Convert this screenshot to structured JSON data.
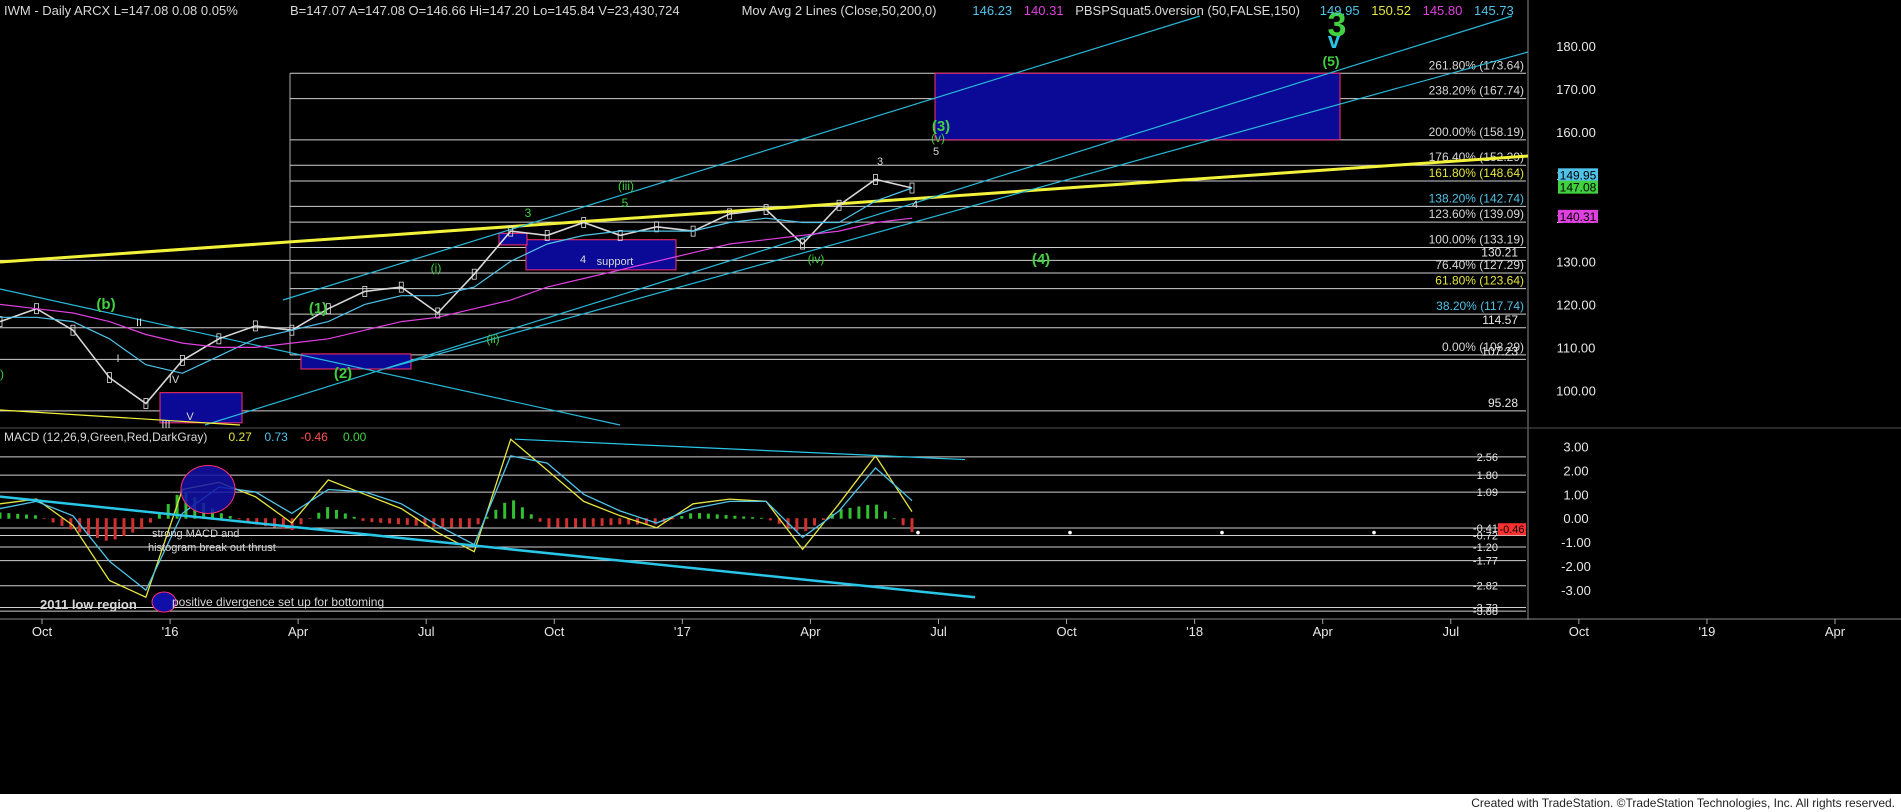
{
  "header": {
    "parts": [
      {
        "text": "IWM - Daily  ARCX  L=147.08  0.08  0.05%",
        "color": "#d8d8d8"
      },
      {
        "text": "B=147.07  A=147.08  O=146.66  Hi=147.20  Lo=145.84  V=23,430,724",
        "color": "#d8d8d8"
      },
      {
        "text": "Mov Avg 2 Lines (Close,50,200,0)",
        "color": "#d8d8d8"
      },
      {
        "text": "146.23",
        "color": "#4fc3e8"
      },
      {
        "text": "140.31",
        "color": "#e040e0"
      },
      {
        "text": "PBSPSquat5.0version (50,FALSE,150)",
        "color": "#d8d8d8"
      },
      {
        "text": "149.95",
        "color": "#4fc3e8"
      },
      {
        "text": "150.52",
        "color": "#e6e640"
      },
      {
        "text": "145.80",
        "color": "#e040e0"
      },
      {
        "text": "145.73",
        "color": "#4fc3e8"
      }
    ]
  },
  "macd_header": {
    "parts": [
      {
        "text": "MACD (12,26,9,Green,Red,DarkGray)",
        "color": "#d8d8d8"
      },
      {
        "text": "0.27",
        "color": "#e6e640"
      },
      {
        "text": "0.73",
        "color": "#4fc3e8"
      },
      {
        "text": "-0.46",
        "color": "#ff5050"
      },
      {
        "text": "0.00",
        "color": "#40d040"
      }
    ]
  },
  "price_axis": {
    "ticks": [
      "180.00",
      "170.00",
      "160.00",
      "150.00",
      "140.00",
      "130.00",
      "120.00",
      "110.00",
      "100.00"
    ],
    "ylim": [
      92,
      186
    ],
    "last_price_tags": [
      {
        "text": "149.95",
        "value": 149.95,
        "bg": "#4fc3e8",
        "fg": "#000"
      },
      {
        "text": "147.08",
        "value": 147.08,
        "bg": "#40d040",
        "fg": "#000"
      },
      {
        "text": "140.31",
        "value": 140.31,
        "bg": "#e040e0",
        "fg": "#000"
      }
    ]
  },
  "macd_axis": {
    "ticks": [
      "3.00",
      "2.00",
      "1.00",
      "0.00",
      "-1.00",
      "-2.00",
      "-3.00"
    ],
    "ylim": [
      -4.0,
      3.6
    ],
    "level_labels": [
      "2.56",
      "1.80",
      "1.09",
      "-0.41",
      "-0.72",
      "-1.20",
      "-1.77",
      "-2.82",
      "-3.73",
      "-3.88"
    ],
    "tag": {
      "text": "-0.46",
      "bg": "#ff3030",
      "fg": "#000"
    }
  },
  "time_axis": {
    "labels": [
      "Oct",
      "'16",
      "Apr",
      "Jul",
      "Oct",
      "'17",
      "Apr",
      "Jul",
      "Oct",
      "'18",
      "Apr",
      "Jul",
      "Oct",
      "'19",
      "Apr"
    ]
  },
  "fib_levels": [
    {
      "label": "261.80% (173.64)",
      "value": 173.64,
      "color": "#d8d8d8"
    },
    {
      "label": "238.20% (167.74)",
      "value": 167.74,
      "color": "#d8d8d8"
    },
    {
      "label": "200.00% (158.19)",
      "value": 158.19,
      "color": "#d8d8d8"
    },
    {
      "label": "176.40% (152.29)",
      "value": 152.29,
      "color": "#d8d8d8"
    },
    {
      "label": "161.80% (148.64)",
      "value": 148.64,
      "color": "#e6e640"
    },
    {
      "label": "138.20% (142.74)",
      "value": 142.74,
      "color": "#4fc3e8"
    },
    {
      "label": "123.60% (139.09)",
      "value": 139.09,
      "color": "#d8d8d8"
    },
    {
      "label": "100.00% (133.19)",
      "value": 133.19,
      "color": "#d8d8d8"
    },
    {
      "label": "76.40% (127.29)",
      "value": 127.29,
      "color": "#d8d8d8"
    },
    {
      "label": "61.80% (123.64)",
      "value": 123.64,
      "color": "#e6e640"
    },
    {
      "label": "38.20% (117.74)",
      "value": 117.74,
      "color": "#4fc3e8"
    },
    {
      "label": "0.00% (108.29)",
      "value": 108.29,
      "color": "#d8d8d8"
    }
  ],
  "horizontal_levels": [
    {
      "label": "130.21",
      "value": 130.21
    },
    {
      "label": "114.57",
      "value": 114.57
    },
    {
      "label": "107.23",
      "value": 107.23
    },
    {
      "label": "95.28",
      "value": 95.28
    }
  ],
  "wave_labels": [
    {
      "text": "3",
      "color": "#40d040",
      "size": 34
    },
    {
      "text": "v",
      "color": "#29c6e8",
      "size": 22
    },
    {
      "text": "(5)",
      "color": "#40d040",
      "size": 14
    },
    {
      "text": "(3)",
      "color": "#40d040",
      "size": 15
    },
    {
      "text": "(v)",
      "color": "#40d040",
      "size": 12
    },
    {
      "text": "5",
      "color": "#d8d8d8",
      "size": 11
    },
    {
      "text": "3",
      "color": "#d8d8d8",
      "size": 11
    },
    {
      "text": "4",
      "color": "#d8d8d8",
      "size": 11
    },
    {
      "text": "(4)",
      "color": "#40d040",
      "size": 15
    },
    {
      "text": "(iv)",
      "color": "#40d040",
      "size": 12
    },
    {
      "text": "(iii)",
      "color": "#40d040",
      "size": 12
    },
    {
      "text": "5",
      "color": "#40d040",
      "size": 12
    },
    {
      "text": "3",
      "color": "#40d040",
      "size": 12
    },
    {
      "text": "4",
      "color": "#d8d8d8",
      "size": 11
    },
    {
      "text": "support",
      "color": "#d8d8d8",
      "size": 11
    },
    {
      "text": "(i)",
      "color": "#40d040",
      "size": 12
    },
    {
      "text": "(ii)",
      "color": "#40d040",
      "size": 12
    },
    {
      "text": "(1)",
      "color": "#40d040",
      "size": 15
    },
    {
      "text": "(2)",
      "color": "#40d040",
      "size": 15
    },
    {
      "text": "(b)",
      "color": "#40d040",
      "size": 15
    },
    {
      "text": "I",
      "color": "#d8d8d8",
      "size": 11
    },
    {
      "text": "II",
      "color": "#d8d8d8",
      "size": 11
    },
    {
      "text": "IV",
      "color": "#d8d8d8",
      "size": 11
    },
    {
      "text": "III",
      "color": "#d8d8d8",
      "size": 11
    },
    {
      "text": "V",
      "color": "#d8d8d8",
      "size": 11
    },
    {
      "text": ")",
      "color": "#40d040",
      "size": 12
    }
  ],
  "macd_annotations": [
    {
      "text": "strong MACD  and",
      "color": "#d8d8d8"
    },
    {
      "text": "histogram break out thrust",
      "color": "#d8d8d8"
    },
    {
      "text": "2011 low region",
      "color": "#d8d8d8"
    },
    {
      "text": "positive divergence set up for bottoming",
      "color": "#d8d8d8"
    }
  ],
  "footer": {
    "text": "Created with TradeStation. ©TradeStation Technologies, Inc. All rights reserved."
  },
  "chart_data": [
    {
      "type": "candlestick-line",
      "title": "IWM - Daily ARCX",
      "ylim": [
        92,
        186
      ],
      "series": [
        {
          "name": "IWM",
          "color": "#d8d8d8",
          "x": [
            "2015-10",
            "2015-11",
            "2015-12",
            "2016-01",
            "2016-02",
            "2016-03",
            "2016-04",
            "2016-05",
            "2016-06",
            "2016-07",
            "2016-08",
            "2016-09",
            "2016-10",
            "2016-11",
            "2016-12",
            "2017-01",
            "2017-02",
            "2017-03",
            "2017-04",
            "2017-05",
            "2017-06",
            "2017-07",
            "2017-08",
            "2017-09",
            "2017-10",
            "2017-11"
          ],
          "values": [
            116,
            119,
            114,
            103,
            97,
            107,
            112,
            115,
            114,
            119,
            123,
            124,
            118,
            127,
            137,
            136,
            139,
            136,
            138,
            137,
            141,
            142,
            134,
            143,
            149,
            147
          ]
        },
        {
          "name": "Mov Avg 50",
          "color": "#4fc3e8",
          "values": [
            117,
            117,
            116,
            112,
            106,
            104,
            108,
            112,
            114,
            116,
            120,
            122,
            122,
            124,
            130,
            134,
            136,
            137,
            137,
            137,
            139,
            140,
            139,
            139,
            144,
            147
          ]
        },
        {
          "name": "Mov Avg 200",
          "color": "#e040e0",
          "values": [
            120,
            119,
            118,
            116,
            113,
            111,
            110,
            110,
            111,
            112,
            114,
            116,
            117,
            119,
            121,
            124,
            126,
            128,
            130,
            132,
            134,
            135,
            136,
            137,
            139,
            140
          ]
        }
      ]
    },
    {
      "type": "line",
      "title": "MACD (12,26,9,Green,Red,DarkGray)",
      "ylim": [
        -4.0,
        3.6
      ],
      "series": [
        {
          "name": "MACD",
          "color": "#e6e640",
          "values": [
            0.6,
            0.8,
            -0.3,
            -2.6,
            -3.3,
            1.2,
            1.5,
            0.9,
            -0.2,
            1.6,
            1.0,
            0.4,
            -0.6,
            -1.4,
            3.3,
            2.0,
            0.7,
            0.1,
            -0.4,
            0.6,
            0.8,
            0.7,
            -1.3,
            0.6,
            2.6,
            0.27
          ]
        },
        {
          "name": "Signal",
          "color": "#4fc3e8",
          "values": [
            0.4,
            0.7,
            0.1,
            -1.8,
            -3.0,
            0.2,
            1.3,
            1.1,
            0.2,
            1.2,
            1.1,
            0.6,
            -0.3,
            -1.1,
            2.6,
            2.3,
            1.0,
            0.3,
            -0.2,
            0.4,
            0.7,
            0.7,
            -0.8,
            0.3,
            2.1,
            0.73
          ]
        }
      ]
    }
  ]
}
